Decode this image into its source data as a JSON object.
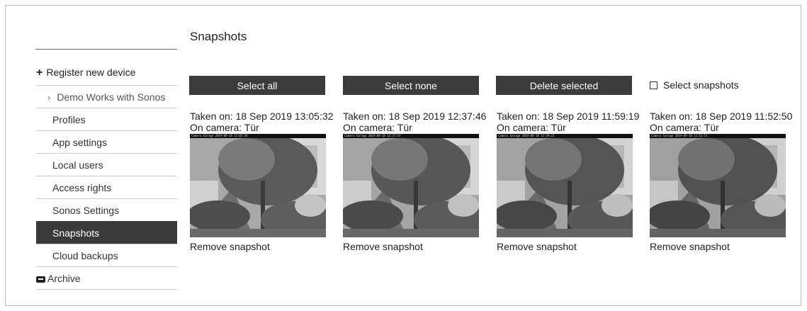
{
  "sidebar": {
    "register_label": "Register new device",
    "items": [
      {
        "label": "Demo Works with Sonos",
        "type": "group"
      },
      {
        "label": "Profiles"
      },
      {
        "label": "App settings"
      },
      {
        "label": "Local users"
      },
      {
        "label": "Access rights"
      },
      {
        "label": "Sonos Settings"
      },
      {
        "label": "Snapshots",
        "active": true
      },
      {
        "label": "Cloud backups"
      },
      {
        "label": "Archive",
        "icon": "archive-box-icon"
      }
    ]
  },
  "main": {
    "title": "Snapshots",
    "toolbar": {
      "select_all": "Select all",
      "select_none": "Select none",
      "delete_selected": "Delete selected",
      "select_snapshots": "Select snapshots"
    },
    "snapshots": [
      {
        "taken": "Taken on: 18 Sep 2019 13:05:32",
        "camera": "On camera: Tür",
        "stamp": "Camera Garage 2019-09-18 13:05:34",
        "remove": "Remove snapshot"
      },
      {
        "taken": "Taken on: 18 Sep 2019 12:37:46",
        "camera": "On camera: Tür",
        "stamp": "Camera Garage 2019-09-18 12:37:47",
        "remove": "Remove snapshot"
      },
      {
        "taken": "Taken on: 18 Sep 2019 11:59:19",
        "camera": "On camera: Tür",
        "stamp": "Camera Garage 2019-09-18 11:59:22",
        "remove": "Remove snapshot"
      },
      {
        "taken": "Taken on: 18 Sep 2019 11:52:50",
        "camera": "On camera: Tür",
        "stamp": "Camera Garage 2019-09-18 11:52:51",
        "remove": "Remove snapshot"
      }
    ]
  }
}
